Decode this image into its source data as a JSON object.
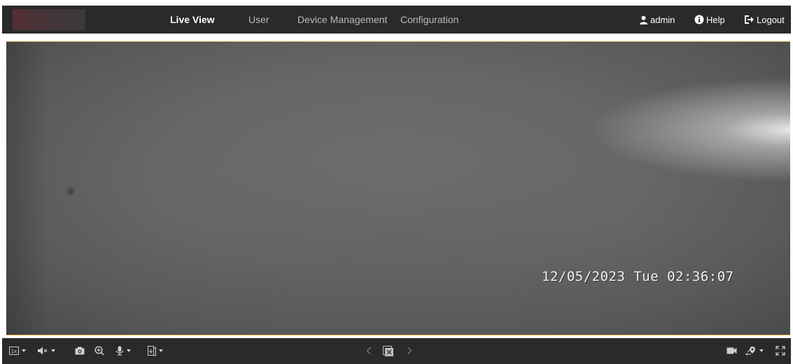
{
  "nav": {
    "items": [
      "Live View",
      "User",
      "Device Management",
      "Configuration"
    ],
    "active": "Live View"
  },
  "utilities": {
    "user_label": "admin",
    "help_label": "Help",
    "logout_label": "Logout"
  },
  "video": {
    "osd_text": "12/05/2023 Tue 02:36:07"
  },
  "toolbar": {
    "left_icons": [
      "window-division-icon",
      "audio-mute-icon",
      "capture-icon",
      "digital-zoom-icon",
      "microphone-icon",
      "stream-type-icon"
    ],
    "center_icons": [
      "previous-icon",
      "stop-all-icon",
      "next-icon"
    ],
    "right_icons": [
      "record-icon",
      "ptz-position-icon",
      "fullscreen-icon"
    ]
  },
  "colors": {
    "topbar": "#2a2a2b",
    "video_border": "#d9a640",
    "text_active": "#ffffff",
    "text_inactive": "#b9b9b9"
  }
}
